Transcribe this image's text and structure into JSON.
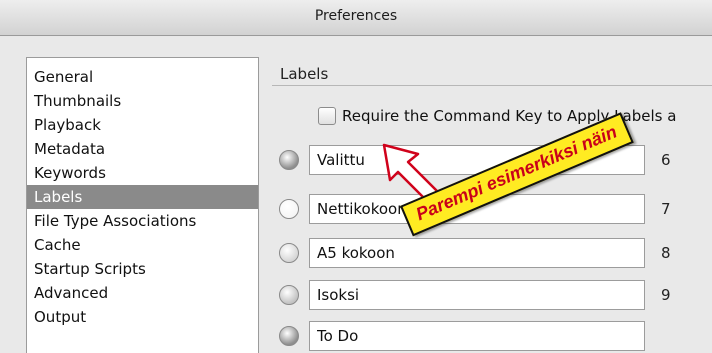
{
  "window": {
    "title": "Preferences"
  },
  "sidebar": {
    "items": [
      {
        "label": "General",
        "selected": false
      },
      {
        "label": "Thumbnails",
        "selected": false
      },
      {
        "label": "Playback",
        "selected": false
      },
      {
        "label": "Metadata",
        "selected": false
      },
      {
        "label": "Keywords",
        "selected": false
      },
      {
        "label": "Labels",
        "selected": true
      },
      {
        "label": "File Type Associations",
        "selected": false
      },
      {
        "label": "Cache",
        "selected": false
      },
      {
        "label": "Startup Scripts",
        "selected": false
      },
      {
        "label": "Advanced",
        "selected": false
      },
      {
        "label": "Output",
        "selected": false
      }
    ]
  },
  "labels_panel": {
    "section_title": "Labels",
    "require_command_key": {
      "label": "Require the Command Key to Apply Labels a",
      "checked": false
    },
    "rows": [
      {
        "value": "Valittu",
        "shortcut": "6",
        "swatch_color": "#8e8e8e"
      },
      {
        "value": "Nettikokoon",
        "shortcut": "7",
        "swatch_color": "#f5f5f5"
      },
      {
        "value": "A5 kokoon",
        "shortcut": "8",
        "swatch_color": "#d6d6d6"
      },
      {
        "value": "Isoksi",
        "shortcut": "9",
        "swatch_color": "#c2c2c2"
      },
      {
        "value": "To Do",
        "shortcut": "",
        "swatch_color": "#8e8e8e"
      }
    ]
  },
  "annotation": {
    "text": "Parempi esimerkiksi näin",
    "fill_color": "#ffeb22",
    "text_color": "#c9001a",
    "arrow_color": "#d0021b"
  }
}
